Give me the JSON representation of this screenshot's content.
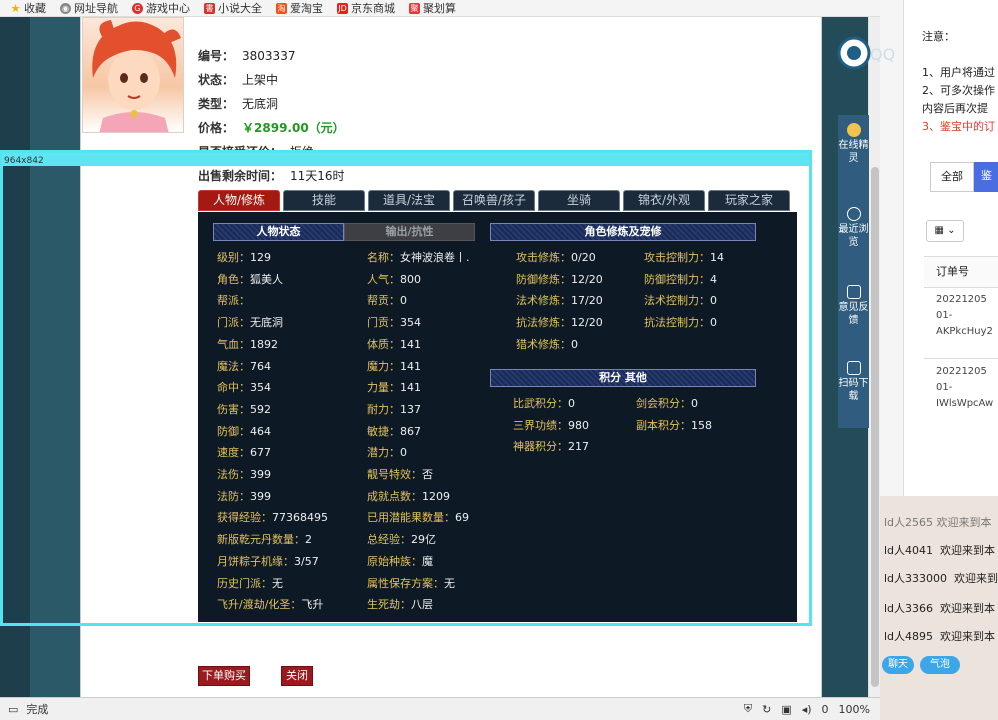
{
  "bookmarks": [
    {
      "label": "收藏",
      "icon": "star-icon"
    },
    {
      "label": "网址导航",
      "icon": "globe-icon"
    },
    {
      "label": "游戏中心",
      "icon": "game-icon"
    },
    {
      "label": "小说大全",
      "icon": "book-icon"
    },
    {
      "label": "爱淘宝",
      "icon": "taobao-icon"
    },
    {
      "label": "京东商城",
      "icon": "jd-icon"
    },
    {
      "label": "聚划算",
      "icon": "juhuasuan-icon"
    }
  ],
  "item": {
    "id_label": "编号：",
    "id": "3803337",
    "status_label": "状态：",
    "status": "上架中",
    "type_label": "类型：",
    "type": "无底洞",
    "price_label": "价格：",
    "price": "￥2899.00（元）",
    "bargain_label": "是否接受还价：",
    "bargain": "拒绝",
    "remaining_label": "出售剩余时间：",
    "remaining": "11天16时"
  },
  "selection_tag": "964x842",
  "tabs": [
    "人物/修炼",
    "技能",
    "道具/法宝",
    "召唤兽/孩子",
    "坐骑",
    "锦衣/外观",
    "玩家之家"
  ],
  "char_panel": {
    "tab_status": "人物状态",
    "tab_resist": "输出/抗性",
    "col1": [
      {
        "k": "级别：",
        "v": "129"
      },
      {
        "k": "角色：",
        "v": "狐美人"
      },
      {
        "k": "帮派：",
        "v": ""
      },
      {
        "k": "门派：",
        "v": "无底洞"
      },
      {
        "k": "气血：",
        "v": "1892"
      },
      {
        "k": "魔法：",
        "v": "764"
      },
      {
        "k": "命中：",
        "v": "354"
      },
      {
        "k": "伤害：",
        "v": "592"
      },
      {
        "k": "防御：",
        "v": "464"
      },
      {
        "k": "速度：",
        "v": "677"
      },
      {
        "k": "法伤：",
        "v": "399"
      },
      {
        "k": "法防：",
        "v": "399"
      },
      {
        "k": "获得经验：",
        "v": "77368495"
      },
      {
        "k": "新版乾元丹数量：",
        "v": "2"
      },
      {
        "k": "月饼粽子机缘：",
        "v": "3/57"
      },
      {
        "k": "历史门派：",
        "v": "无"
      },
      {
        "k": "飞升/渡劫/化圣：",
        "v": "飞升"
      }
    ],
    "col2": [
      {
        "k": "名称：",
        "v": "女神波浪卷丨."
      },
      {
        "k": "人气：",
        "v": "800"
      },
      {
        "k": "帮贡：",
        "v": "0"
      },
      {
        "k": "门贡：",
        "v": "354"
      },
      {
        "k": "体质：",
        "v": "141"
      },
      {
        "k": "魔力：",
        "v": "141"
      },
      {
        "k": "力量：",
        "v": "141"
      },
      {
        "k": "耐力：",
        "v": "137"
      },
      {
        "k": "敏捷：",
        "v": "867"
      },
      {
        "k": "潜力：",
        "v": "0"
      },
      {
        "k": "靓号特效：",
        "v": "否"
      },
      {
        "k": "成就点数：",
        "v": "1209"
      },
      {
        "k": "已用潜能果数量：",
        "v": "69"
      },
      {
        "k": "总经验：",
        "v": "29亿"
      },
      {
        "k": "原始种族：",
        "v": "魔"
      },
      {
        "k": "属性保存方案：",
        "v": "无"
      },
      {
        "k": "生死劫：",
        "v": "八层"
      }
    ],
    "cultivation_title": "角色修炼及宠修",
    "cultivation": [
      {
        "k": "攻击修炼：",
        "v": "0/20",
        "k2": "攻击控制力：",
        "v2": "14"
      },
      {
        "k": "防御修炼：",
        "v": "12/20",
        "k2": "防御控制力：",
        "v2": "4"
      },
      {
        "k": "法术修炼：",
        "v": "17/20",
        "k2": "法术控制力：",
        "v2": "0"
      },
      {
        "k": "抗法修炼：",
        "v": "12/20",
        "k2": "抗法控制力：",
        "v2": "0"
      },
      {
        "k": "猎术修炼：",
        "v": "0",
        "k2": "",
        "v2": ""
      }
    ],
    "points_title": "积分 其他",
    "points": [
      {
        "k": "比武积分：",
        "v": "0",
        "k2": "剑会积分：",
        "v2": "0"
      },
      {
        "k": "三界功绩：",
        "v": "980",
        "k2": "副本积分：",
        "v2": "158"
      },
      {
        "k": "神器积分：",
        "v": "217",
        "k2": "",
        "v2": ""
      }
    ]
  },
  "buttons": {
    "buy": "下单购买",
    "close": "关闭"
  },
  "status_bar": {
    "text": "完成",
    "zoom": "100%",
    "count": "0"
  },
  "sidebar": [
    {
      "label": "在线精灵"
    },
    {
      "label": "最近浏览"
    },
    {
      "label": "意见反馈"
    },
    {
      "label": "扫码下载"
    }
  ],
  "right_panel": {
    "notice_title": "注意：",
    "notes": [
      "1、用户将通过",
      "2、可多次操作",
      "内容后再次提",
      "3、鉴宝中的订"
    ],
    "filter_all": "全部",
    "filter_active": "鉴",
    "order_header": "订单号",
    "orders": [
      [
        "20221205",
        "01-",
        "AKPkcHuy2"
      ],
      [
        "20221205",
        "01-",
        "IWlsWpcAw"
      ]
    ]
  },
  "chat_lines": [
    {
      "user": "ld人4041",
      "msg": "欢迎来到本"
    },
    {
      "user": "ld人333000",
      "msg": "欢迎来到"
    },
    {
      "user": "ld人3366",
      "msg": "欢迎来到本"
    },
    {
      "user": "ld人4895",
      "msg": "欢迎来到本"
    }
  ],
  "chat_pills": [
    "聊天",
    "气泡"
  ]
}
